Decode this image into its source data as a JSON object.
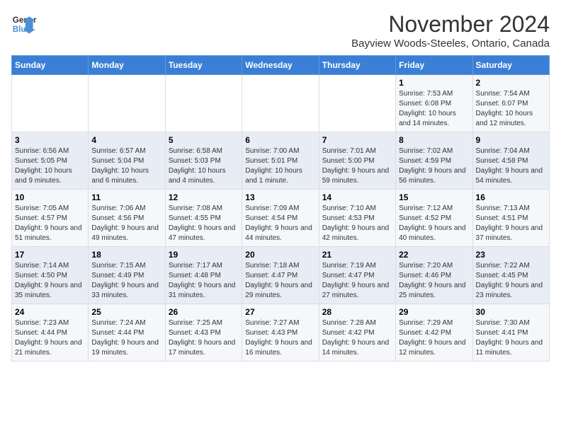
{
  "logo": {
    "line1": "General",
    "line2": "Blue"
  },
  "title": "November 2024",
  "subtitle": "Bayview Woods-Steeles, Ontario, Canada",
  "days_of_week": [
    "Sunday",
    "Monday",
    "Tuesday",
    "Wednesday",
    "Thursday",
    "Friday",
    "Saturday"
  ],
  "weeks": [
    [
      {
        "day": "",
        "info": ""
      },
      {
        "day": "",
        "info": ""
      },
      {
        "day": "",
        "info": ""
      },
      {
        "day": "",
        "info": ""
      },
      {
        "day": "",
        "info": ""
      },
      {
        "day": "1",
        "info": "Sunrise: 7:53 AM\nSunset: 6:08 PM\nDaylight: 10 hours and 14 minutes."
      },
      {
        "day": "2",
        "info": "Sunrise: 7:54 AM\nSunset: 6:07 PM\nDaylight: 10 hours and 12 minutes."
      }
    ],
    [
      {
        "day": "3",
        "info": "Sunrise: 6:56 AM\nSunset: 5:05 PM\nDaylight: 10 hours and 9 minutes."
      },
      {
        "day": "4",
        "info": "Sunrise: 6:57 AM\nSunset: 5:04 PM\nDaylight: 10 hours and 6 minutes."
      },
      {
        "day": "5",
        "info": "Sunrise: 6:58 AM\nSunset: 5:03 PM\nDaylight: 10 hours and 4 minutes."
      },
      {
        "day": "6",
        "info": "Sunrise: 7:00 AM\nSunset: 5:01 PM\nDaylight: 10 hours and 1 minute."
      },
      {
        "day": "7",
        "info": "Sunrise: 7:01 AM\nSunset: 5:00 PM\nDaylight: 9 hours and 59 minutes."
      },
      {
        "day": "8",
        "info": "Sunrise: 7:02 AM\nSunset: 4:59 PM\nDaylight: 9 hours and 56 minutes."
      },
      {
        "day": "9",
        "info": "Sunrise: 7:04 AM\nSunset: 4:58 PM\nDaylight: 9 hours and 54 minutes."
      }
    ],
    [
      {
        "day": "10",
        "info": "Sunrise: 7:05 AM\nSunset: 4:57 PM\nDaylight: 9 hours and 51 minutes."
      },
      {
        "day": "11",
        "info": "Sunrise: 7:06 AM\nSunset: 4:56 PM\nDaylight: 9 hours and 49 minutes."
      },
      {
        "day": "12",
        "info": "Sunrise: 7:08 AM\nSunset: 4:55 PM\nDaylight: 9 hours and 47 minutes."
      },
      {
        "day": "13",
        "info": "Sunrise: 7:09 AM\nSunset: 4:54 PM\nDaylight: 9 hours and 44 minutes."
      },
      {
        "day": "14",
        "info": "Sunrise: 7:10 AM\nSunset: 4:53 PM\nDaylight: 9 hours and 42 minutes."
      },
      {
        "day": "15",
        "info": "Sunrise: 7:12 AM\nSunset: 4:52 PM\nDaylight: 9 hours and 40 minutes."
      },
      {
        "day": "16",
        "info": "Sunrise: 7:13 AM\nSunset: 4:51 PM\nDaylight: 9 hours and 37 minutes."
      }
    ],
    [
      {
        "day": "17",
        "info": "Sunrise: 7:14 AM\nSunset: 4:50 PM\nDaylight: 9 hours and 35 minutes."
      },
      {
        "day": "18",
        "info": "Sunrise: 7:15 AM\nSunset: 4:49 PM\nDaylight: 9 hours and 33 minutes."
      },
      {
        "day": "19",
        "info": "Sunrise: 7:17 AM\nSunset: 4:48 PM\nDaylight: 9 hours and 31 minutes."
      },
      {
        "day": "20",
        "info": "Sunrise: 7:18 AM\nSunset: 4:47 PM\nDaylight: 9 hours and 29 minutes."
      },
      {
        "day": "21",
        "info": "Sunrise: 7:19 AM\nSunset: 4:47 PM\nDaylight: 9 hours and 27 minutes."
      },
      {
        "day": "22",
        "info": "Sunrise: 7:20 AM\nSunset: 4:46 PM\nDaylight: 9 hours and 25 minutes."
      },
      {
        "day": "23",
        "info": "Sunrise: 7:22 AM\nSunset: 4:45 PM\nDaylight: 9 hours and 23 minutes."
      }
    ],
    [
      {
        "day": "24",
        "info": "Sunrise: 7:23 AM\nSunset: 4:44 PM\nDaylight: 9 hours and 21 minutes."
      },
      {
        "day": "25",
        "info": "Sunrise: 7:24 AM\nSunset: 4:44 PM\nDaylight: 9 hours and 19 minutes."
      },
      {
        "day": "26",
        "info": "Sunrise: 7:25 AM\nSunset: 4:43 PM\nDaylight: 9 hours and 17 minutes."
      },
      {
        "day": "27",
        "info": "Sunrise: 7:27 AM\nSunset: 4:43 PM\nDaylight: 9 hours and 16 minutes."
      },
      {
        "day": "28",
        "info": "Sunrise: 7:28 AM\nSunset: 4:42 PM\nDaylight: 9 hours and 14 minutes."
      },
      {
        "day": "29",
        "info": "Sunrise: 7:29 AM\nSunset: 4:42 PM\nDaylight: 9 hours and 12 minutes."
      },
      {
        "day": "30",
        "info": "Sunrise: 7:30 AM\nSunset: 4:41 PM\nDaylight: 9 hours and 11 minutes."
      }
    ]
  ]
}
